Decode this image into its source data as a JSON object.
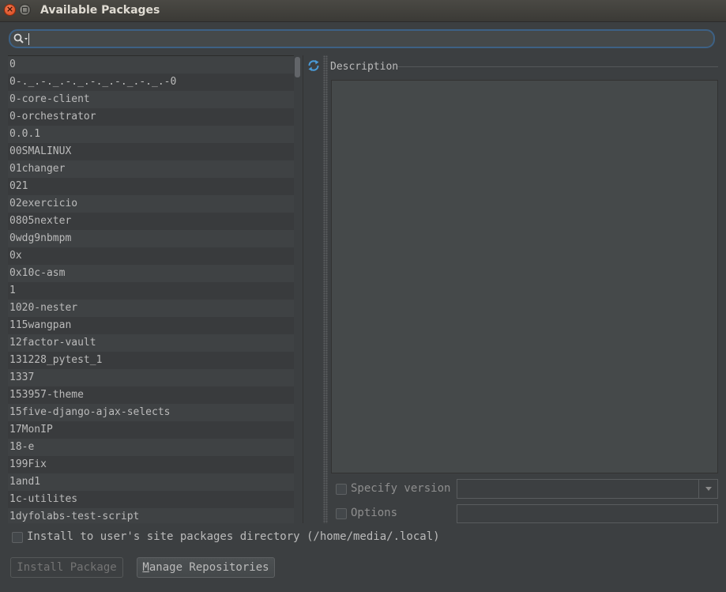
{
  "window": {
    "title": "Available Packages"
  },
  "search": {
    "value": ""
  },
  "packages": [
    "0",
    "0-._.-._.-._.-._.-._.-._.-0",
    "0-core-client",
    "0-orchestrator",
    "0.0.1",
    "00SMALINUX",
    "01changer",
    "021",
    "02exercicio",
    "0805nexter",
    "0wdg9nbmpm",
    "0x",
    "0x10c-asm",
    "1",
    "1020-nester",
    "115wangpan",
    "12factor-vault",
    "131228_pytest_1",
    "1337",
    "153957-theme",
    "15five-django-ajax-selects",
    "17MonIP",
    "18-e",
    "199Fix",
    "1and1",
    "1c-utilites",
    "1dyfolabs-test-script"
  ],
  "description": {
    "label": "Description",
    "text": ""
  },
  "options": {
    "specify_version_label": "Specify version",
    "options_label": "Options",
    "version_value": "",
    "options_value": ""
  },
  "install_to_user": {
    "label": "Install to user's site packages directory (/home/media/.local)"
  },
  "buttons": {
    "install": "Install Package",
    "manage_first": "M",
    "manage_rest": "anage Repositories"
  },
  "colors": {
    "accent": "#3d6185",
    "refresh": "#4a9bd8",
    "close": "#e45c2b"
  },
  "icons": [
    "close-icon",
    "minimize-icon",
    "search-icon",
    "refresh-icon",
    "chevron-down-icon"
  ]
}
